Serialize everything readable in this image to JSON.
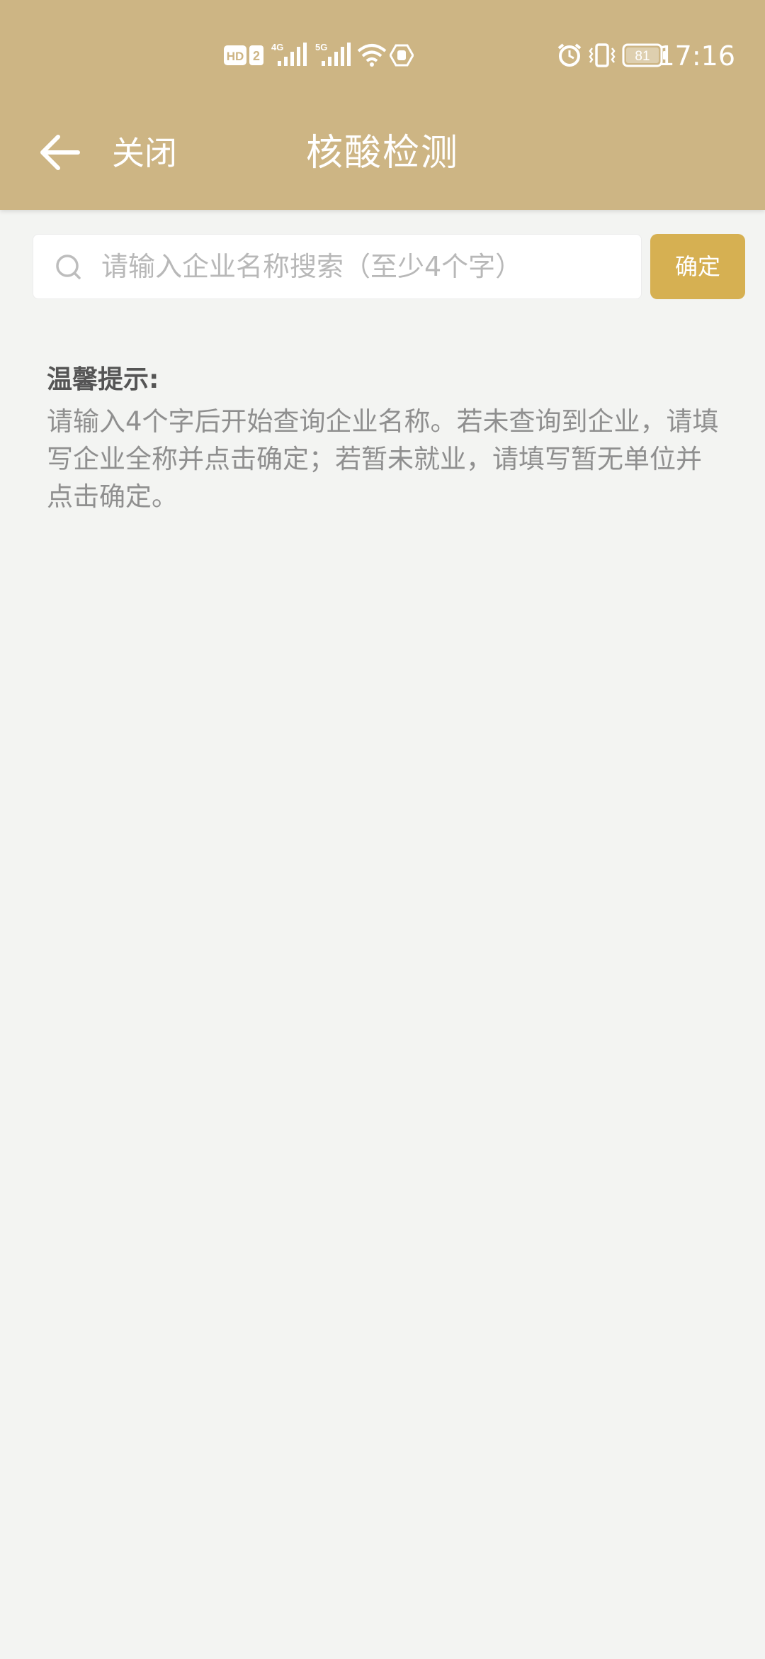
{
  "status_bar": {
    "time": "17:16",
    "hd_label": "HD",
    "sim_number": "2",
    "net1": "4G",
    "net2": "5G",
    "battery": "81",
    "icons": [
      "hd-icon",
      "signal-4g-icon",
      "signal-5g-icon",
      "wifi-icon",
      "hotspot-icon",
      "alarm-icon",
      "vibrate-icon",
      "battery-icon"
    ]
  },
  "nav": {
    "back_icon": "arrow-left-icon",
    "close_label": "关闭",
    "title": "核酸检测"
  },
  "search": {
    "placeholder": "请输入企业名称搜索（至少4个字）",
    "value": "",
    "icon": "search-icon",
    "confirm_label": "确定"
  },
  "tips": {
    "title": "温馨提示:",
    "body": "请输入4个字后开始查询企业名称。若未查询到企业，请填写企业全称并点击确定；若暂未就业，请填写暂无单位并点击确定。"
  },
  "colors": {
    "header": "#cdb584",
    "background": "#f3f4f2",
    "confirm_button": "#d6b052",
    "tips_title": "#555555",
    "tips_body": "#8f8f8f"
  }
}
